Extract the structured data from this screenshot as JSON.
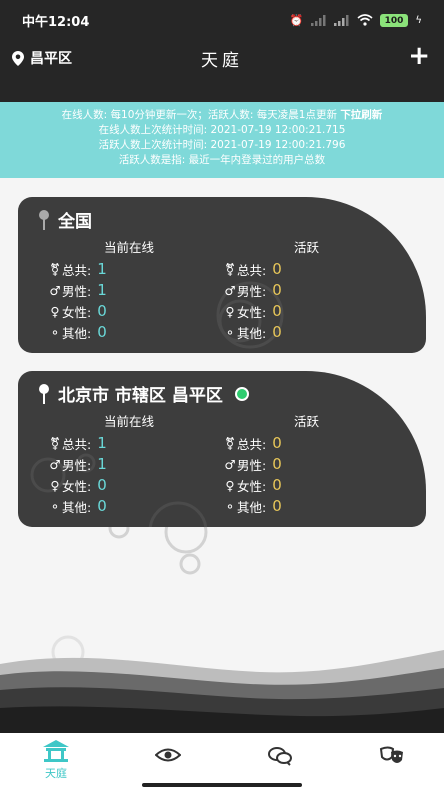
{
  "status_bar": {
    "time": "中午12:04",
    "battery": "100"
  },
  "header": {
    "location": "昌平区",
    "title": "天庭",
    "add_label": "+"
  },
  "info": {
    "line1_prefix": "在线人数: 每10分钟更新一次；活跃人数: 每天凌晨1点更新 ",
    "line1_action": "下拉刷新",
    "line2": "在线人数上次统计时间: 2021-07-19 12:00:21.715",
    "line3": "活跃人数上次统计时间: 2021-07-19 12:00:21.796",
    "line4": "活跃人数是指: 最近一年内登录过的用户总数"
  },
  "cards": [
    {
      "title": "全国",
      "online_label": "当前在线",
      "active_label": "活跃",
      "rows": [
        {
          "label": "总共:",
          "online": "1",
          "active": "0"
        },
        {
          "label": "男性:",
          "online": "1",
          "active": "0"
        },
        {
          "label": "女性:",
          "online": "0",
          "active": "0"
        },
        {
          "label": "其他:",
          "online": "0",
          "active": "0"
        }
      ]
    },
    {
      "title": "北京市 市辖区 昌平区",
      "online_label": "当前在线",
      "active_label": "活跃",
      "rows": [
        {
          "label": "总共:",
          "online": "1",
          "active": "0"
        },
        {
          "label": "男性:",
          "online": "1",
          "active": "0"
        },
        {
          "label": "女性:",
          "online": "0",
          "active": "0"
        },
        {
          "label": "其他:",
          "online": "0",
          "active": "0"
        }
      ]
    }
  ],
  "nav": {
    "items": [
      {
        "icon": "pavilion-icon",
        "label": "天庭",
        "active": true
      },
      {
        "icon": "eye-icon",
        "label": ""
      },
      {
        "icon": "chat-icon",
        "label": ""
      },
      {
        "icon": "masks-icon",
        "label": ""
      }
    ]
  },
  "colors": {
    "header_bg": "#262626",
    "banner_bg": "#7fd9d9",
    "card_bg": "#3d3d3d",
    "online_value": "#6ad8d8",
    "active_value": "#e7c659",
    "accent": "#3ec7c7"
  }
}
